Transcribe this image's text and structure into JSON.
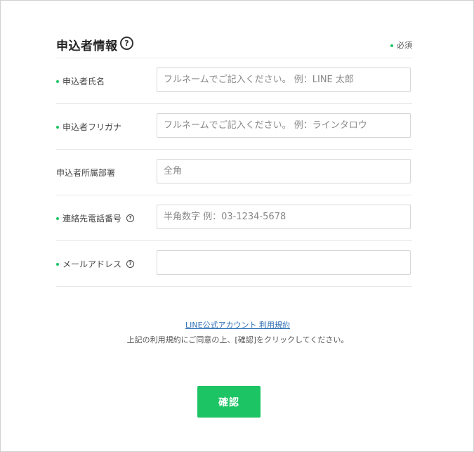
{
  "section": {
    "title": "申込者情報",
    "help_glyph": "?",
    "required_legend": "必須"
  },
  "fields": [
    {
      "label": "申込者氏名",
      "required": true,
      "help": false,
      "placeholder": "フルネームでご記入ください。 例：LINE 太郎",
      "value": ""
    },
    {
      "label": "申込者フリガナ",
      "required": true,
      "help": false,
      "placeholder": "フルネームでご記入ください。 例：ラインタロウ",
      "value": ""
    },
    {
      "label": "申込者所属部署",
      "required": false,
      "help": false,
      "placeholder": "全角",
      "value": ""
    },
    {
      "label": "連絡先電話番号",
      "required": true,
      "help": true,
      "placeholder": "半角数字 例：03-1234-5678",
      "value": ""
    },
    {
      "label": "メールアドレス",
      "required": true,
      "help": true,
      "placeholder": "",
      "value": ""
    }
  ],
  "terms": {
    "link_text": "LINE公式アカウント 利用規約",
    "note": "上記の利用規約にご同意の上、[確認]をクリックしてください。"
  },
  "actions": {
    "confirm_label": "確認"
  },
  "colors": {
    "accent": "#1dc464",
    "link": "#2d6fb5"
  }
}
